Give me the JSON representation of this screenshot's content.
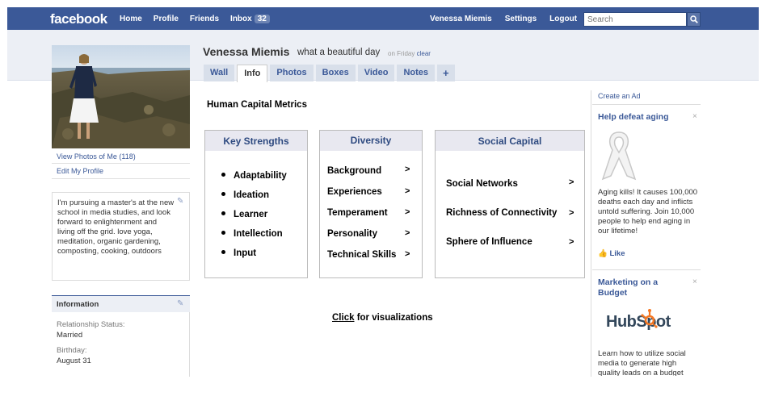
{
  "header": {
    "logo": "facebook",
    "nav": [
      "Home",
      "Profile",
      "Friends"
    ],
    "inbox_label": "Inbox",
    "inbox_count": "32",
    "user_name": "Venessa Miemis",
    "settings": "Settings",
    "logout": "Logout",
    "search_placeholder": "Search"
  },
  "sidebar": {
    "view_photos": "View Photos of Me (118)",
    "edit_profile": "Edit My Profile",
    "bio": "I'm pursuing a master's at the new school in media studies, and look forward to enlightenment and living off the grid. love yoga, meditation, organic gardening, composting, cooking, outdoors",
    "info_title": "Information",
    "relationship_label": "Relationship Status:",
    "relationship_value": "Married",
    "birthday_label": "Birthday:",
    "birthday_value": "August 31"
  },
  "profile": {
    "name": "Venessa Miemis",
    "status": "what a beautiful day",
    "time": "on Friday",
    "clear": "clear"
  },
  "tabs": [
    "Wall",
    "Info",
    "Photos",
    "Boxes",
    "Video",
    "Notes",
    "+"
  ],
  "main": {
    "title": "Human Capital Metrics",
    "strengths": {
      "title": "Key Strengths",
      "items": [
        "Adaptability",
        "Ideation",
        "Learner",
        "Intellection",
        "Input"
      ]
    },
    "diversity": {
      "title": "Diversity",
      "items": [
        "Background",
        "Experiences",
        "Temperament",
        "Personality",
        "Technical Skills"
      ]
    },
    "social": {
      "title": "Social Capital",
      "items": [
        "Social Networks",
        "Richness of Connectivity",
        "Sphere of Influence"
      ]
    },
    "arrow": ">",
    "click_word": "Click",
    "click_rest": " for visualizations"
  },
  "ads": {
    "create": "Create an Ad",
    "ad1_title": "Help defeat aging",
    "ad1_text": "Aging kills! It causes 100,000 deaths each day and inflicts untold suffering. Join 10,000 people to help end aging in our lifetime!",
    "like": "Like",
    "ad2_title": "Marketing on a Budget",
    "ad2_logo": "HubSpot",
    "ad2_text": "Learn how to utilize social media to generate high quality leads on a budget",
    "close": "×"
  },
  "colors": {
    "brand": "#3b5998",
    "band": "#eceff5",
    "tab": "#d8dfea",
    "hubspot": "#f57722"
  }
}
